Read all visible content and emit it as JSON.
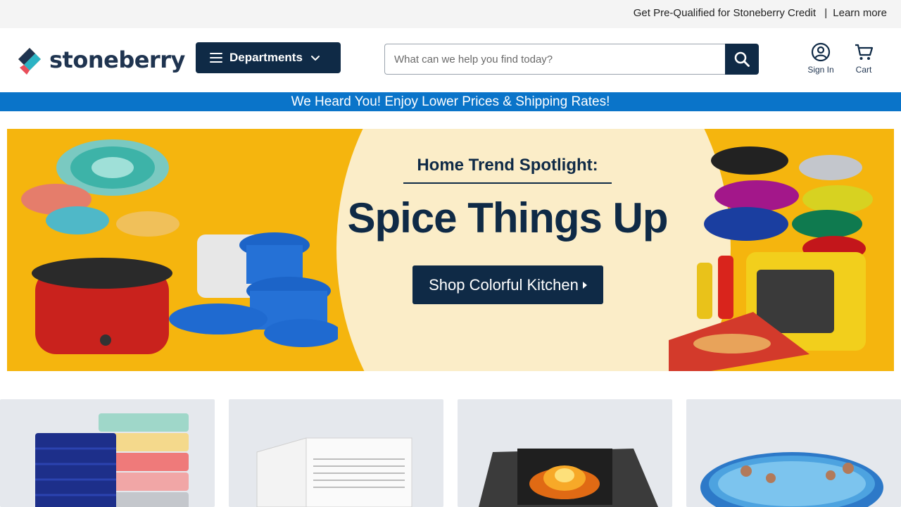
{
  "topbar": {
    "credit_text": "Get Pre-Qualified for Stoneberry Credit",
    "separator": "|",
    "learn_more": "Learn more"
  },
  "header": {
    "logo_text": "stoneberry",
    "departments_label": "Departments",
    "search_placeholder": "What can we help you find today?",
    "sign_in_label": "Sign In",
    "cart_label": "Cart"
  },
  "promo": {
    "text": "We Heard You! Enjoy Lower Prices & Shipping Rates!"
  },
  "hero": {
    "kicker": "Home Trend Spotlight:",
    "headline": "Spice Things Up",
    "cta": "Shop Colorful Kitchen"
  },
  "tiles": [
    {
      "icon": "towels-image"
    },
    {
      "icon": "air-conditioner-image"
    },
    {
      "icon": "fire-pit-image"
    },
    {
      "icon": "pool-image"
    }
  ],
  "colors": {
    "navy": "#0f2a46",
    "promo_blue": "#0a74c9",
    "hero_yellow": "#f5b50e",
    "hero_cream": "#fbedc8"
  }
}
